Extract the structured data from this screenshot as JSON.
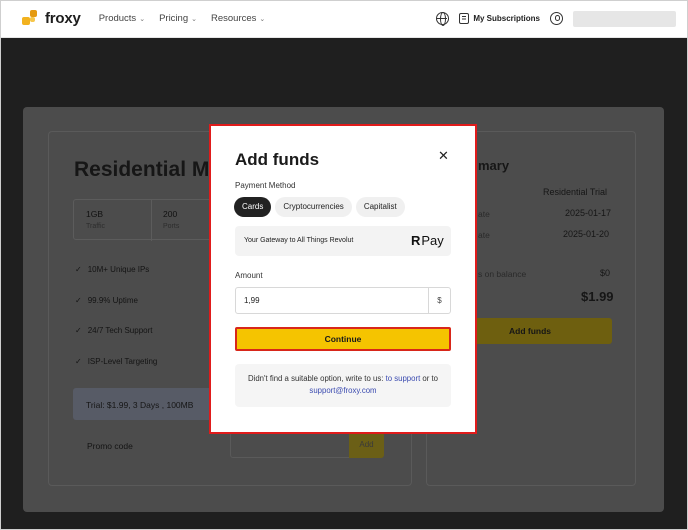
{
  "header": {
    "logo_text": "froxy",
    "nav": [
      {
        "label": "Products"
      },
      {
        "label": "Pricing"
      },
      {
        "label": "Resources"
      }
    ],
    "subscriptions_label": "My Subscriptions"
  },
  "background": {
    "plan_title": "Residential M",
    "stats": [
      {
        "value": "1GB",
        "label": "Traffic"
      },
      {
        "value": "200",
        "label": "Ports"
      }
    ],
    "features": [
      "10M+ Unique IPs",
      "99.9% Uptime",
      "24/7 Tech Support",
      "ISP-Level Targeting"
    ],
    "trial_text": "Trial: $1.99, 3 Days , 100MB",
    "promo_label": "Promo code",
    "promo_button": "Add",
    "summary": {
      "title_partial": "mary",
      "plan_name": "Residential Trial",
      "row1_key": "ate",
      "row1_value": "2025-01-17",
      "row2_key": "ate",
      "row2_value": "2025-01-20",
      "balance_key": "s on balance",
      "balance_value": "$0",
      "total_value": "$1.99",
      "button": "Add funds"
    }
  },
  "modal": {
    "title": "Add funds",
    "close_icon": "close-icon",
    "payment_method_label": "Payment Method",
    "tabs": [
      {
        "label": "Cards",
        "active": true
      },
      {
        "label": "Cryptocurrencies",
        "active": false
      },
      {
        "label": "Capitalist",
        "active": false
      }
    ],
    "revolut_text": "Your Gateway to All Things Revolut",
    "revolut_logo_r": "R",
    "revolut_logo_text": "Pay",
    "amount_label": "Amount",
    "amount_value": "1,99",
    "currency": "$",
    "continue_label": "Continue",
    "help_text_1": "Didn't find a suitable option, write to us:",
    "help_link_1": "to support",
    "help_text_2": "or to",
    "help_link_2": "support@froxy.com"
  },
  "colors": {
    "accent": "#f5c400",
    "highlight": "#e01b1b",
    "link": "#3b4bb0"
  }
}
